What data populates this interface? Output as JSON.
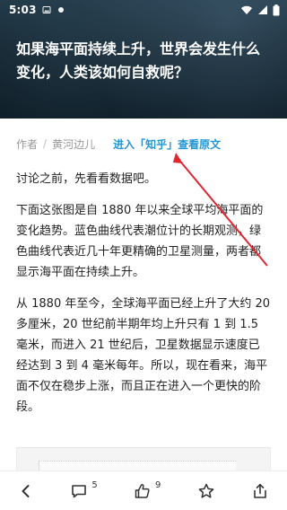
{
  "status_bar": {
    "time": "5:03",
    "left_icons": [
      "notification-image-icon",
      "notification-dot-icon"
    ],
    "right_icons": [
      "wifi-icon",
      "signal-icon",
      "battery-icon"
    ]
  },
  "article": {
    "title": "如果海平面持续上升，世界会发生什么变化，人类该如何自救呢？",
    "author_label": "作者",
    "author_separator": "/",
    "author_name": "黄河边儿",
    "source_link": "进入「知乎」查看原文",
    "paragraphs": [
      "讨论之前，先看看数据吧。",
      "下面这张图是自 1880 年以来全球平均海平面的变化趋势。蓝色曲线代表潮位计的长期观测，绿色曲线代表近几十年更精确的卫星测量，两者都显示海平面在持续上升。",
      "从 1880 年至今，全球海平面已经上升了大约 20 多厘米，20 世纪前半期年均上升只有 1 到 1.5 毫米，而进入 21 世纪后，卫星数据显示速度已经达到 3 到 4 毫米每年。所以，现在看来，海平面不仅在稳步上涨，而且正在进入一个更快的阶段。"
    ]
  },
  "bottom_bar": {
    "comments_count": "5",
    "likes_count": "9"
  },
  "colors": {
    "link": "#1f97d6",
    "annotation_arrow": "#e0262e",
    "hero_overlay": "#1c2f3c"
  }
}
